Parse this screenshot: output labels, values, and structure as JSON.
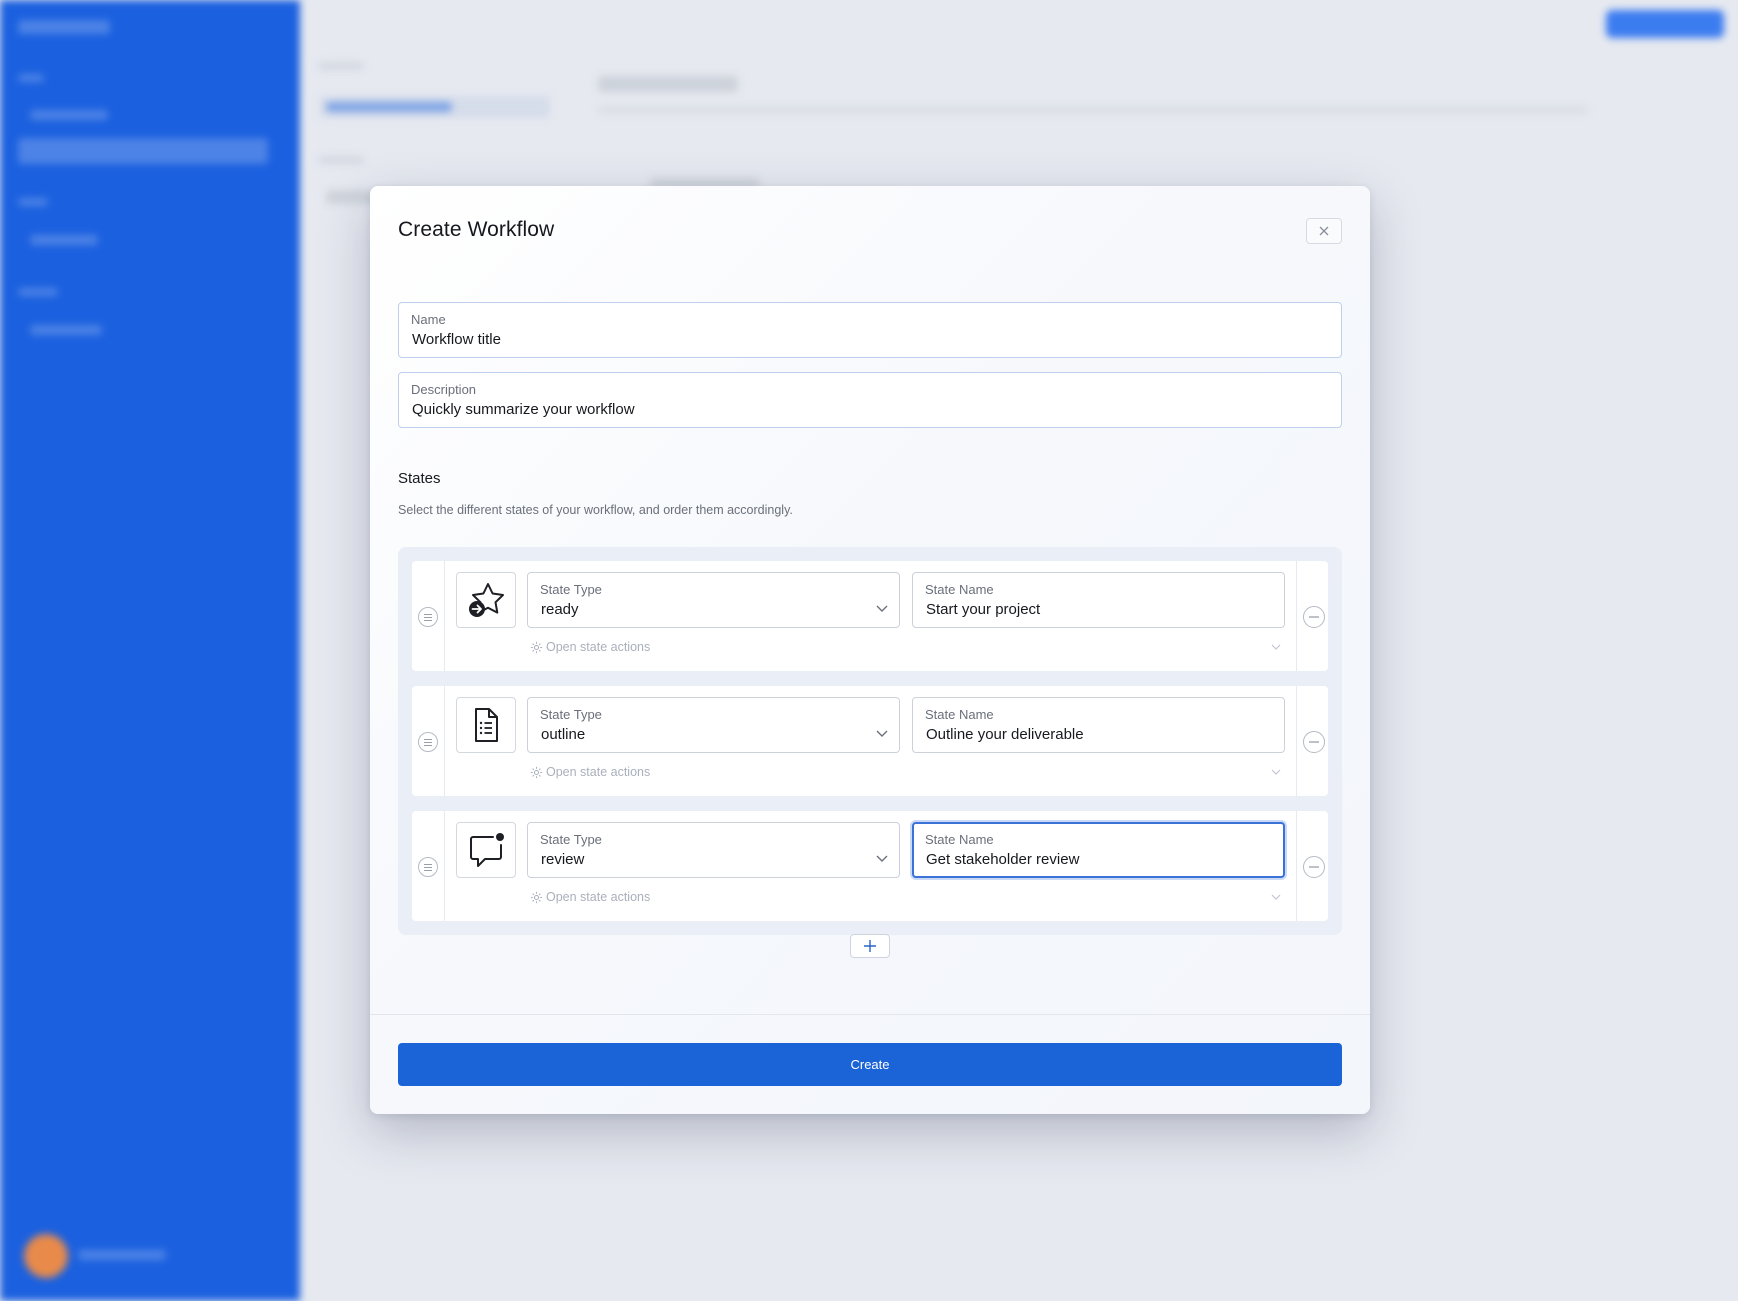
{
  "modal": {
    "title": "Create Workflow",
    "name_field": {
      "label": "Name",
      "value": "Workflow title"
    },
    "description_field": {
      "label": "Description",
      "value": "Quickly summarize your workflow"
    },
    "states_section": {
      "title": "States",
      "description": "Select the different states of your workflow, and order them accordingly."
    },
    "states": [
      {
        "icon": "star-arrow-icon",
        "type_label": "State Type",
        "type_value": "ready",
        "name_label": "State Name",
        "name_value": "Start your project",
        "actions_label": "Open state actions",
        "focused": false
      },
      {
        "icon": "document-list-icon",
        "type_label": "State Type",
        "type_value": "outline",
        "name_label": "State Name",
        "name_value": "Outline your deliverable",
        "actions_label": "Open state actions",
        "focused": false
      },
      {
        "icon": "chat-notification-icon",
        "type_label": "State Type",
        "type_value": "review",
        "name_label": "State Name",
        "name_value": "Get stakeholder review",
        "actions_label": "Open state actions",
        "focused": true
      }
    ],
    "create_label": "Create"
  },
  "colors": {
    "primary": "#1a64d8",
    "sidebar": "#1b60df",
    "focus": "#3a72d8"
  }
}
